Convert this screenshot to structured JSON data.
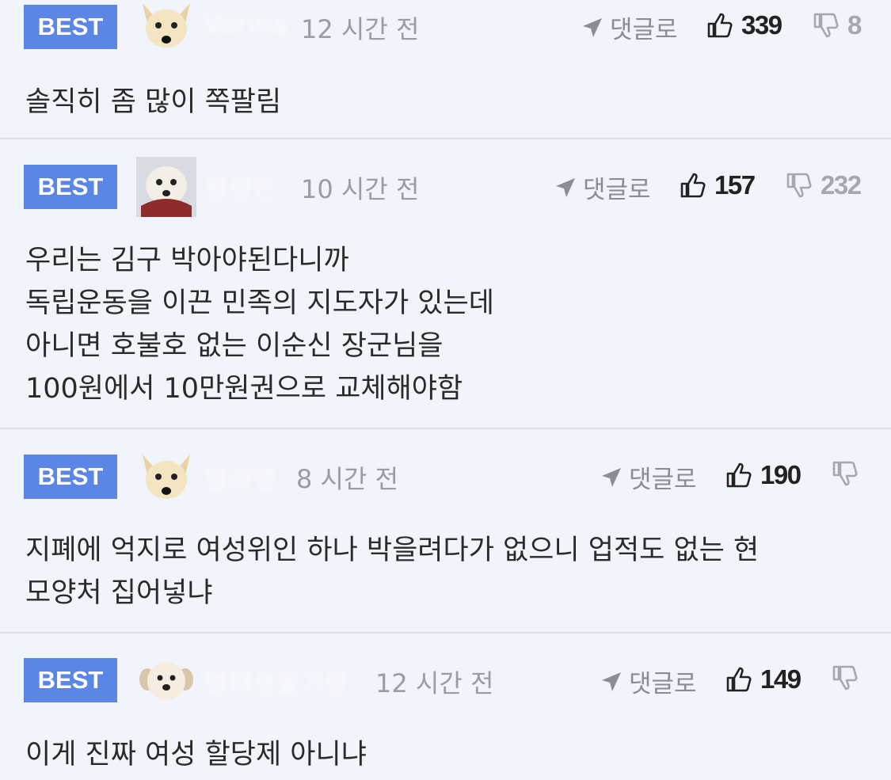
{
  "comments": [
    {
      "badge": "BEST",
      "nickname": "Vorina",
      "time": "12 시간 전",
      "reply_label": "댓글로",
      "likes": "339",
      "dislikes": "8",
      "body": "솔직히 좀 많이 쪽팔림"
    },
    {
      "badge": "BEST",
      "nickname": "원정인",
      "time": "10 시간 전",
      "reply_label": "댓글로",
      "likes": "157",
      "dislikes": "232",
      "body": "우리는 김구 박아야된다니까\n독립운동을 이끈 민족의 지도자가 있는데\n아니면 호불호 없는 이순신 장군님을\n100원에서 10만원권으로 교체해야함"
    },
    {
      "badge": "BEST",
      "nickname": "발리엔",
      "time": "8 시간 전",
      "reply_label": "댓글로",
      "likes": "190",
      "dislikes": "",
      "body": "지폐에 억지로 여성위인 하나 박을려다가 없으니 업적도 없는 현\n모양처 집어넣냐"
    },
    {
      "badge": "BEST",
      "nickname": "멀티생활기랑",
      "time": "12 시간 전",
      "reply_label": "댓글로",
      "likes": "149",
      "dislikes": "",
      "body": "이게 진짜 여성 할당제 아니냐"
    }
  ],
  "icons": {
    "reply": "reply-arrow-icon",
    "like": "thumbs-up-icon",
    "dislike": "thumbs-down-icon"
  },
  "colors": {
    "badge": "#5b86e6",
    "background": "#f2f4fb",
    "divider": "#dcdfe6"
  }
}
